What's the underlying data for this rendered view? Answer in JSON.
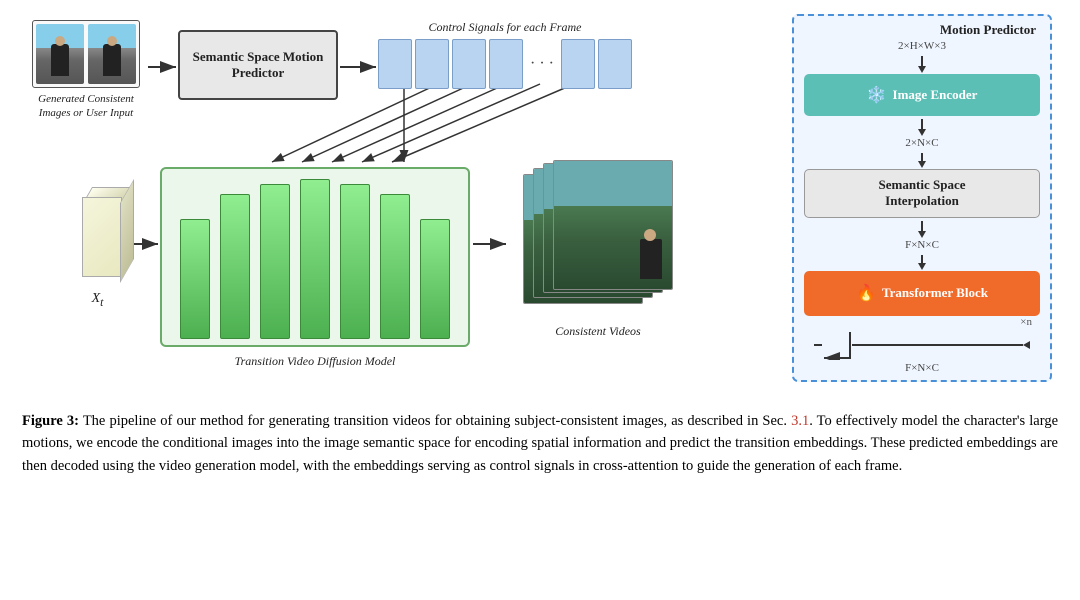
{
  "diagram": {
    "input_label": "Generated Consistent\nImages or User Input",
    "ssmp_label": "Semantic Space\nMotion Predictor",
    "control_label": "Control Signals for each Frame",
    "xt_label": "X",
    "xt_subscript": "t",
    "tvdm_label": "Transition Video Diffusion Model",
    "cv_label": "Consistent Videos",
    "mp": {
      "title": "Motion Predictor",
      "dim1": "2×H×W×3",
      "image_encoder": "Image Encoder",
      "dim2": "2×N×C",
      "interpolation_line1": "Semantic Space",
      "interpolation_line2": "Interpolation",
      "dim3": "F×N×C",
      "transformer": "Transformer Block",
      "xn": "×n",
      "dim4": "F×N×C"
    }
  },
  "caption": {
    "figure_label": "Figure 3:",
    "ref": "3.1",
    "text": "  The pipeline of our method for generating transition videos for obtaining subject-consistent images, as described in Sec. 3.1.  To effectively model the character's large motions, we encode the conditional images into the image semantic space for encoding spatial information and predict the transition embeddings.  These predicted embeddings are then decoded using the video generation model, with the embeddings serving as control signals in cross-attention to guide the generation of each frame."
  }
}
